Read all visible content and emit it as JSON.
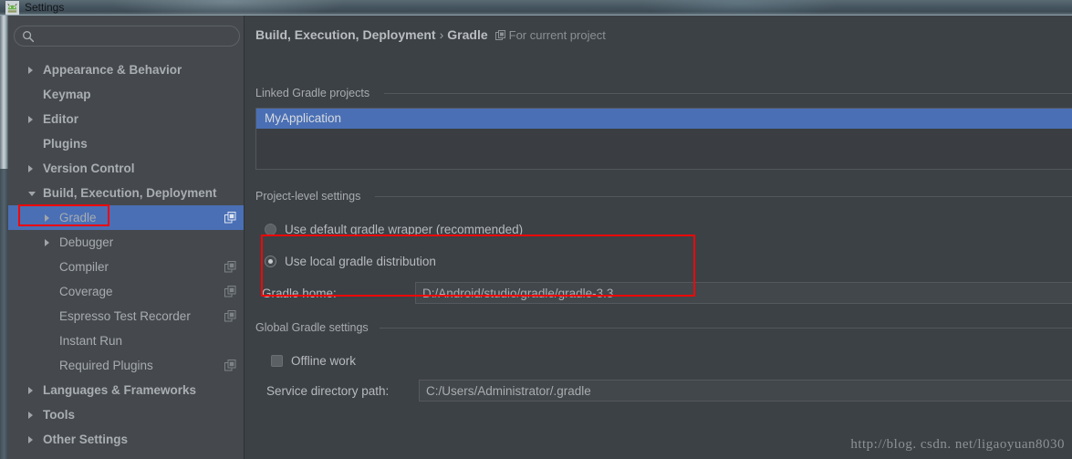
{
  "window": {
    "title": "Settings",
    "app_icon": "android-studio-icon"
  },
  "sidebar": {
    "search": {
      "value": "",
      "placeholder": ""
    },
    "items": [
      {
        "label": "Appearance & Behavior",
        "arrow": "right",
        "indent": 1,
        "bold": true,
        "selected": false,
        "scope_icon": false
      },
      {
        "label": "Keymap",
        "arrow": "none",
        "indent": 1,
        "bold": true,
        "selected": false,
        "scope_icon": false
      },
      {
        "label": "Editor",
        "arrow": "right",
        "indent": 1,
        "bold": true,
        "selected": false,
        "scope_icon": false
      },
      {
        "label": "Plugins",
        "arrow": "none",
        "indent": 1,
        "bold": true,
        "selected": false,
        "scope_icon": false
      },
      {
        "label": "Version Control",
        "arrow": "right",
        "indent": 1,
        "bold": true,
        "selected": false,
        "scope_icon": false
      },
      {
        "label": "Build, Execution, Deployment",
        "arrow": "down",
        "indent": 1,
        "bold": true,
        "selected": false,
        "scope_icon": false
      },
      {
        "label": "Gradle",
        "arrow": "right",
        "indent": 2,
        "bold": false,
        "selected": true,
        "scope_icon": true
      },
      {
        "label": "Debugger",
        "arrow": "right",
        "indent": 2,
        "bold": false,
        "selected": false,
        "scope_icon": false
      },
      {
        "label": "Compiler",
        "arrow": "none",
        "indent": 2,
        "bold": false,
        "selected": false,
        "scope_icon": true
      },
      {
        "label": "Coverage",
        "arrow": "none",
        "indent": 2,
        "bold": false,
        "selected": false,
        "scope_icon": true
      },
      {
        "label": "Espresso Test Recorder",
        "arrow": "none",
        "indent": 2,
        "bold": false,
        "selected": false,
        "scope_icon": true
      },
      {
        "label": "Instant Run",
        "arrow": "none",
        "indent": 2,
        "bold": false,
        "selected": false,
        "scope_icon": false
      },
      {
        "label": "Required Plugins",
        "arrow": "none",
        "indent": 2,
        "bold": false,
        "selected": false,
        "scope_icon": true
      },
      {
        "label": "Languages & Frameworks",
        "arrow": "right",
        "indent": 1,
        "bold": true,
        "selected": false,
        "scope_icon": false
      },
      {
        "label": "Tools",
        "arrow": "right",
        "indent": 1,
        "bold": true,
        "selected": false,
        "scope_icon": false
      },
      {
        "label": "Other Settings",
        "arrow": "right",
        "indent": 1,
        "bold": true,
        "selected": false,
        "scope_icon": false
      }
    ]
  },
  "main": {
    "breadcrumb": {
      "parent": "Build, Execution, Deployment",
      "separator": "›",
      "current": "Gradle",
      "scope_note": "For current project"
    },
    "linked_projects": {
      "caption": "Linked Gradle projects",
      "rows": [
        {
          "label": "MyApplication",
          "selected": true
        }
      ]
    },
    "project_level": {
      "caption": "Project-level settings",
      "wrapper_option": {
        "label": "Use default gradle wrapper (recommended)",
        "checked": false
      },
      "local_option": {
        "label": "Use local gradle distribution",
        "checked": true
      },
      "gradle_home": {
        "label": "Gradle home:",
        "value": "D:/Android/studio/gradle/gradle-3.3",
        "placeholder": ""
      }
    },
    "global_settings": {
      "caption": "Global Gradle settings",
      "offline_work": {
        "label": "Offline work",
        "checked": false
      },
      "service_directory": {
        "label": "Service directory path:",
        "value": "C:/Users/Administrator/.gradle",
        "placeholder": ""
      }
    },
    "watermark": "http://blog. csdn. net/ligaoyuan8030"
  },
  "colors": {
    "selection_blue": "#4a6fb5",
    "annotation_red": "#ef0808",
    "panel_bg": "#3c4146",
    "sidebar_bg": "#45494d"
  }
}
